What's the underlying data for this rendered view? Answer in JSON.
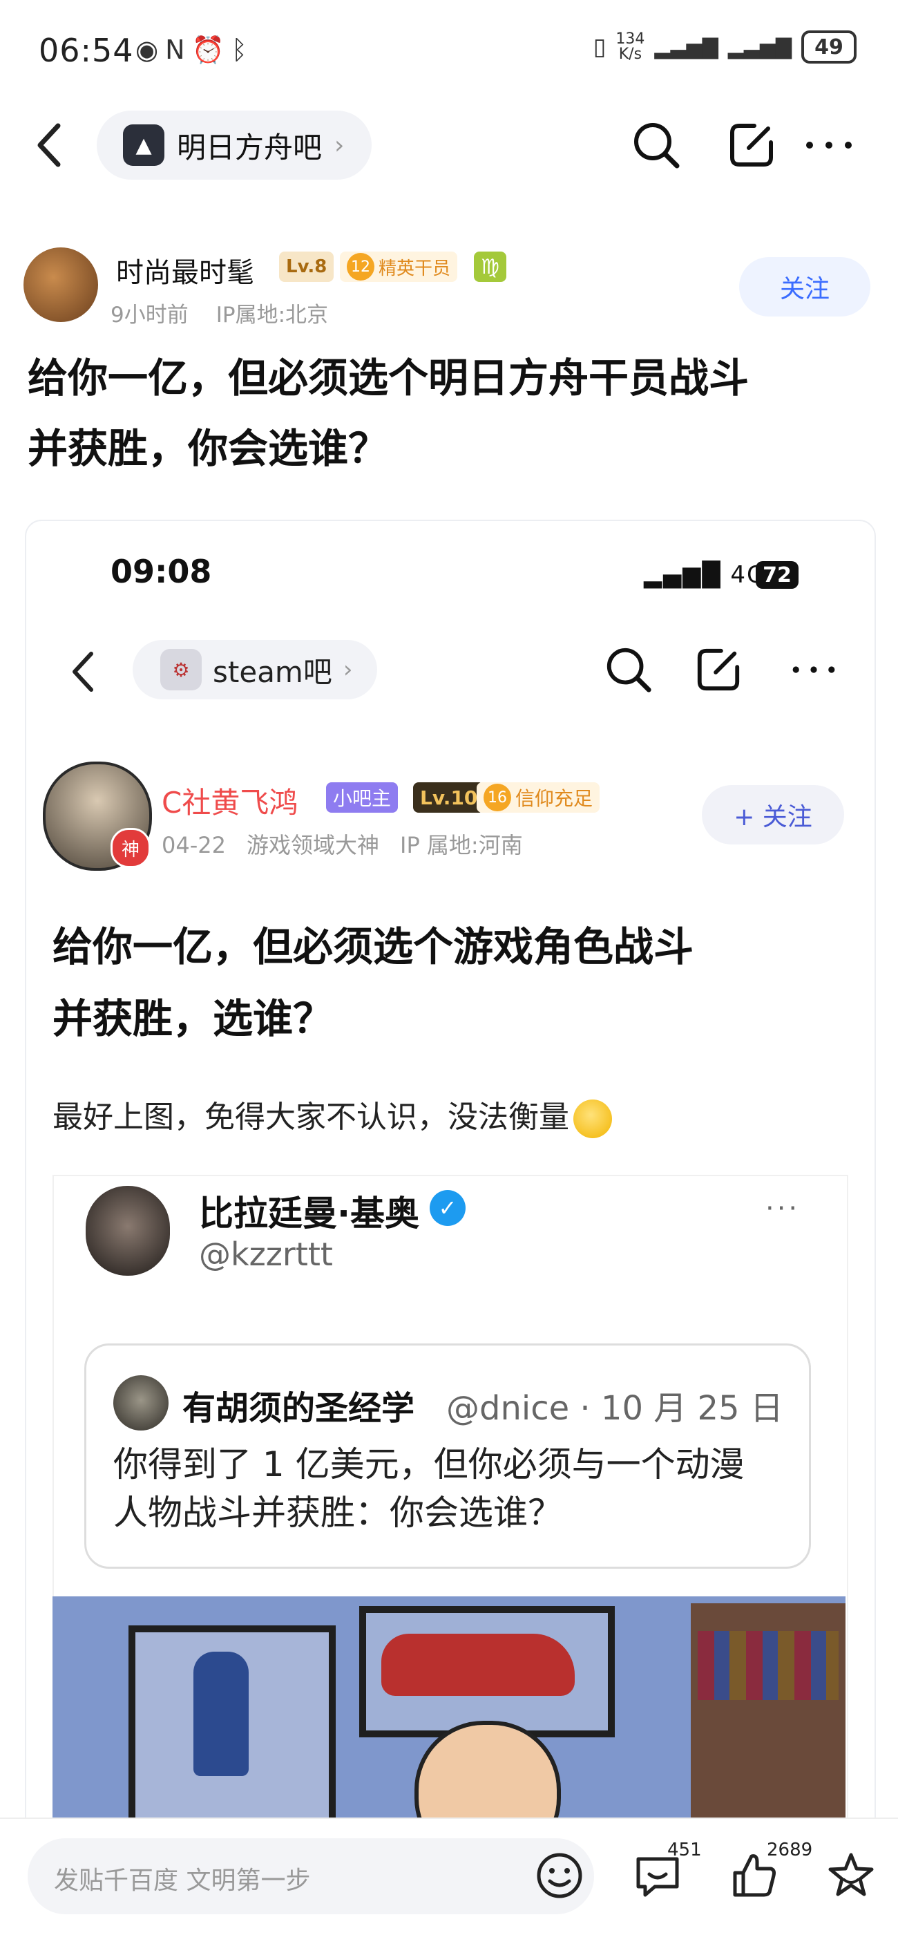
{
  "status_bar": {
    "time": "06:54",
    "net_speed_value": "134",
    "net_speed_unit": "K/s",
    "battery": "49"
  },
  "nav": {
    "forum_name": "明日方舟吧",
    "chevron": "›"
  },
  "post": {
    "author": "时尚最时髦",
    "level": "Lv.8",
    "badge_num": "12",
    "badge_label": "精英干员",
    "zodiac": "♍",
    "time_ago": "9小时前",
    "ip": "IP属地:北京",
    "follow_label": "关注",
    "title_line1": "给你一亿，但必须选个明日方舟干员战斗",
    "title_line2": "并获胜，你会选谁？"
  },
  "embedded": {
    "time": "09:08",
    "network": "4G",
    "battery": "72",
    "forum_name": "steam吧",
    "chevron": "›",
    "author": "C社黄飞鸿",
    "role_badge": "小吧主",
    "level": "Lv.10",
    "badge_num": "16",
    "badge_label": "信仰充足",
    "god_tag": "神",
    "date": "04-22",
    "title_tag": "游戏领域大神",
    "ip": "IP 属地:河南",
    "follow_label": "+ 关注",
    "title_line1": "给你一亿，但必须选个游戏角色战斗",
    "title_line2": "并获胜，选谁？",
    "body": "最好上图，免得大家不认识，没法衡量"
  },
  "tweet": {
    "name": "比拉廷曼·基奥",
    "handle": "@kzzrttt",
    "more": "···",
    "quote_name": "有胡须的圣经学",
    "quote_meta": "@dnice · 10 月 25 日",
    "quote_text_line1": "你得到了 1 亿美元，但你必须与一个动漫",
    "quote_text_line2": "人物战斗并获胜：你会选谁？"
  },
  "bottom_bar": {
    "placeholder": "发贴千百度 文明第一步",
    "comment_count": "451",
    "like_count": "2689"
  }
}
